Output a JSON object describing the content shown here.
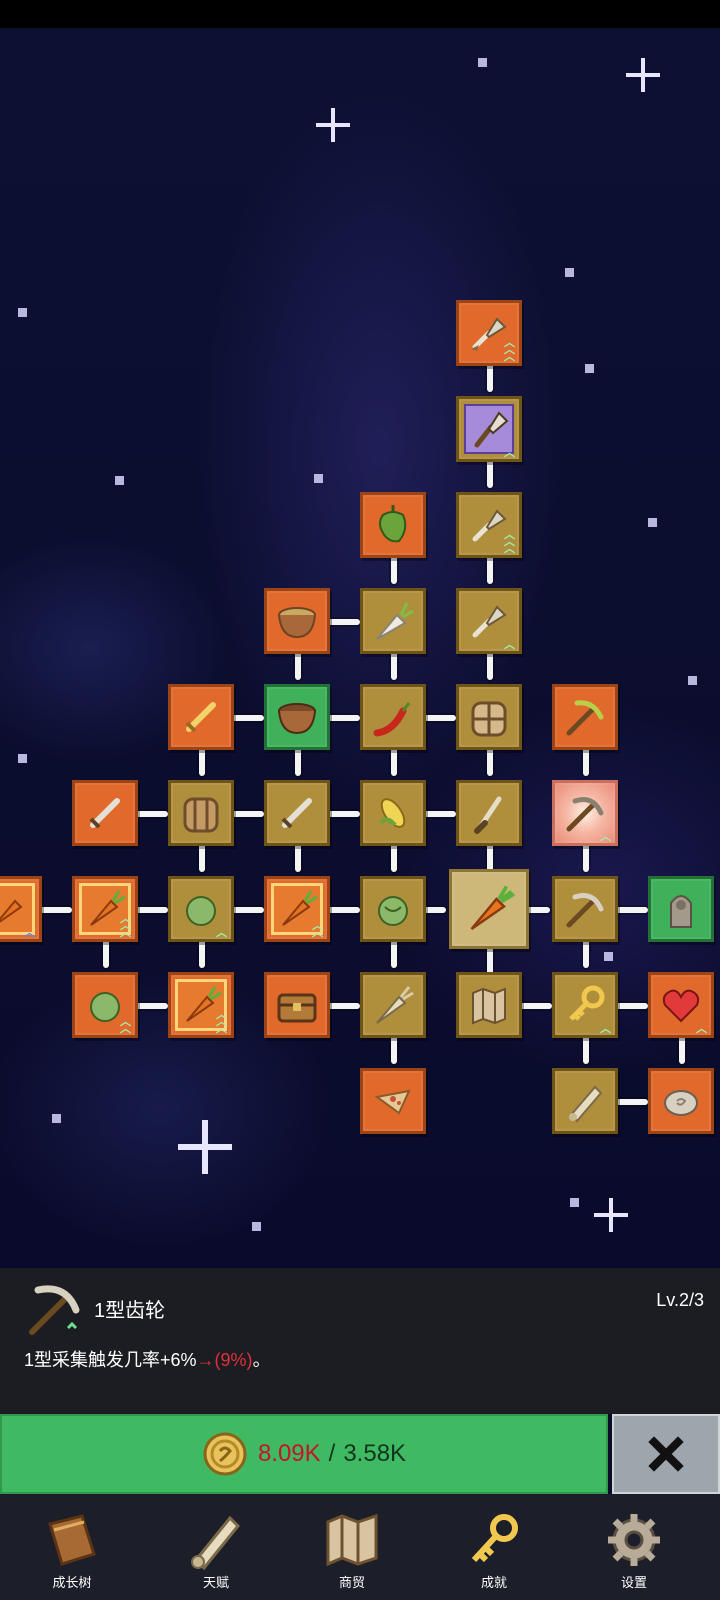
{
  "selected_skill": {
    "name": "1型齿轮",
    "level": "Lv.2/3",
    "desc_main": "1型采集触发几率+6%",
    "desc_arrow": "→",
    "desc_next": "(9%)",
    "desc_end": "。"
  },
  "upgrade": {
    "current_coins": "8.09K",
    "separator": "/",
    "cost": "3.58K"
  },
  "bottom_nav": [
    {
      "label": "成长树",
      "icon": "book-icon"
    },
    {
      "label": "天赋",
      "icon": "scroll-icon"
    },
    {
      "label": "商贸",
      "icon": "map-icon"
    },
    {
      "label": "成就",
      "icon": "key-icon"
    },
    {
      "label": "设置",
      "icon": "gear-icon"
    }
  ],
  "colors": {
    "upgrade_green": "#3fba62",
    "cost_red": "#c4142a",
    "node_orange": "#e1692c",
    "node_gold": "#b08f3c",
    "node_green": "#3fb15a"
  }
}
